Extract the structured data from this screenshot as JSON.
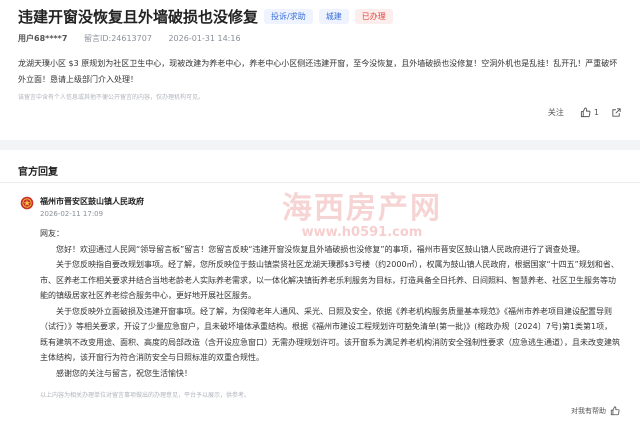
{
  "post": {
    "title": "违建开窗没恢复且外墙破损也没修复",
    "tags": [
      "投诉/求助",
      "城建",
      "已办理"
    ],
    "user": "用户68****7",
    "message_id_label": "留言ID:24613707",
    "date": "2026-01-31 14:16",
    "content": "龙湖天璞小区 $3 原规划为社区卫生中心，现被改建为养老中心，养老中心小区侧还违建开窗，至今没恢复，且外墙破损也没修复！空洞外机也是乱挂！乱开孔！严重破坏外立面！恳请上级部门介入处理！",
    "disclaimer": "该留言中含有个人信息或其他不便公开留言的内容，仅办理机构可见。",
    "follow_label": "关注",
    "like_count": "1",
    "icons": {
      "like": "thumb-up-icon",
      "share": "share-icon"
    }
  },
  "reply": {
    "section_title": "官方回复",
    "org_name": "福州市晋安区鼓山镇人民政府",
    "org_icon": "government-emblem-icon",
    "time": "2026-02-11 17:09",
    "greeting": "网友：",
    "paragraphs": [
      "您好！欢迎通过人民网“领导留言板”留言！您留言反映“违建开窗没恢复且外墙破损也没修复”的事项，福州市晋安区鼓山镇人民政府进行了调查处理。",
      "关于您反映指自要改规划事项。经了解，您所反映位于鼓山镇崇贤社区龙湖天璞郡$3号楼（约2000㎡），权属为鼓山镇人民政府，根据国家“十四五”规划和省、市、区养老工作相关要求并结合当地老龄老人实际养老需求，以一体化解决镇街养老乐利服务为目标，打造具备全日托养、日间照料、智慧养老、社区卫生服务等功能的镇级居家社区养老综合服务中心，更好地开展社区服务。",
      "关于您反映外立面破损及违建开窗事项。经了解，为保障老年人通风、采光、日照及安全，依据《养老机构服务质量基本规范》《福州市养老项目建设配置导则（试行）》等相关要求，开设了少量应急窗户，且未破坏墙体承重结构。根据《福州市建设工程规划许可豁免清单(第一批)》(榕政办规〔2024〕7号)第1类第1项，既有建筑不改变用途、面积、高度的局部改造（含开设应急窗口）无需办理规划许可。该开窗系为满足养老机构消防安全强制性要求（应急逃生通道），且未改变建筑主体结构，该开窗行为符合消防安全与日照标准的双重合规性。",
      "感谢您的关注与留言，祝您生活愉快！"
    ],
    "disclaimer": "以上内容为相关办理单位对留言事项做出的办理意见，平台予以展示，供参考。",
    "helpful_label": "对我有帮助",
    "helpful_icon": "thumb-up-icon"
  },
  "watermark": {
    "main": "海西房产网",
    "url": "www.h0591.com"
  },
  "colors": {
    "accent_blue": "#3a6fd8",
    "status_red": "#e0463a",
    "watermark_red": "#dc3c3c",
    "emblem_red": "#c8302a"
  }
}
